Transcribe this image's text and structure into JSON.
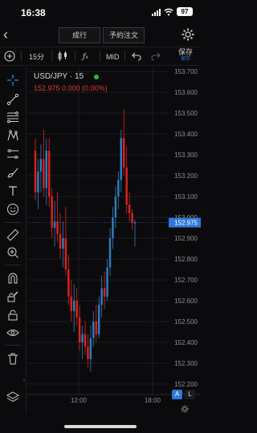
{
  "status": {
    "time": "16:38",
    "battery": "97"
  },
  "topbar": {
    "market_label": "成行",
    "order_label": "予約注文"
  },
  "toolbar": {
    "interval": "15分",
    "price_type": "MID",
    "save_label": "保存",
    "save_sub": "保存"
  },
  "legend": {
    "symbol": "USD/JPY · 15",
    "values": "152.975  0.000 (0.00%)"
  },
  "axis": {
    "price_ticks": [
      "153.700",
      "153.600",
      "153.500",
      "153.400",
      "153.300",
      "153.200",
      "153.100",
      "153.000",
      "152.900",
      "152.800",
      "152.700",
      "152.600",
      "152.500",
      "152.400",
      "152.300",
      "152.200"
    ],
    "current_price": "152.975",
    "time_ticks": [
      "12:00",
      "18:00"
    ]
  },
  "bottom": {
    "auto_label": "A",
    "log_label": "L"
  },
  "colors": {
    "up": "#2f7fc1",
    "down": "#e0211f",
    "accent": "#2f78d9",
    "live_dot": "#2fb54b"
  },
  "icons": [
    "crosshair-icon",
    "trend-line-icon",
    "fib-icon",
    "pattern-icon",
    "projection-icon",
    "brush-icon",
    "text-icon",
    "emoji-icon",
    "ruler-icon",
    "zoom-in-icon",
    "magnet-icon",
    "lock-pencil-icon",
    "lock-icon",
    "eye-icon",
    "trash-icon",
    "layers-icon"
  ],
  "chart_data": {
    "type": "candlestick",
    "symbol": "USD/JPY",
    "interval": "15",
    "x_ticks": [
      "12:00",
      "18:00"
    ],
    "ylim": [
      152.15,
      153.72
    ],
    "candles": [
      {
        "o": 153.32,
        "h": 153.38,
        "l": 153.08,
        "c": 153.12
      },
      {
        "o": 153.12,
        "h": 153.28,
        "l": 153.04,
        "c": 153.22
      },
      {
        "o": 153.22,
        "h": 153.35,
        "l": 153.12,
        "c": 153.28
      },
      {
        "o": 153.28,
        "h": 153.42,
        "l": 153.1,
        "c": 153.14
      },
      {
        "o": 153.14,
        "h": 153.38,
        "l": 153.06,
        "c": 153.32
      },
      {
        "o": 153.32,
        "h": 153.38,
        "l": 153.05,
        "c": 153.1
      },
      {
        "o": 153.1,
        "h": 153.14,
        "l": 152.9,
        "c": 152.95
      },
      {
        "o": 152.95,
        "h": 153.08,
        "l": 152.86,
        "c": 152.98
      },
      {
        "o": 152.98,
        "h": 153.12,
        "l": 152.88,
        "c": 152.92
      },
      {
        "o": 152.92,
        "h": 153.02,
        "l": 152.8,
        "c": 152.85
      },
      {
        "o": 152.85,
        "h": 152.98,
        "l": 152.76,
        "c": 152.9
      },
      {
        "o": 152.9,
        "h": 153.05,
        "l": 152.72,
        "c": 152.75
      },
      {
        "o": 152.75,
        "h": 152.82,
        "l": 152.58,
        "c": 152.62
      },
      {
        "o": 152.62,
        "h": 152.7,
        "l": 152.5,
        "c": 152.55
      },
      {
        "o": 152.55,
        "h": 152.68,
        "l": 152.45,
        "c": 152.6
      },
      {
        "o": 152.6,
        "h": 152.66,
        "l": 152.48,
        "c": 152.52
      },
      {
        "o": 152.52,
        "h": 152.58,
        "l": 152.36,
        "c": 152.4
      },
      {
        "o": 152.4,
        "h": 152.48,
        "l": 152.32,
        "c": 152.44
      },
      {
        "o": 152.44,
        "h": 152.5,
        "l": 152.34,
        "c": 152.38
      },
      {
        "o": 152.38,
        "h": 152.44,
        "l": 152.28,
        "c": 152.32
      },
      {
        "o": 152.32,
        "h": 152.48,
        "l": 152.26,
        "c": 152.42
      },
      {
        "o": 152.42,
        "h": 152.55,
        "l": 152.38,
        "c": 152.5
      },
      {
        "o": 152.5,
        "h": 152.58,
        "l": 152.4,
        "c": 152.44
      },
      {
        "o": 152.44,
        "h": 152.62,
        "l": 152.42,
        "c": 152.58
      },
      {
        "o": 152.58,
        "h": 152.72,
        "l": 152.52,
        "c": 152.66
      },
      {
        "o": 152.66,
        "h": 152.74,
        "l": 152.56,
        "c": 152.62
      },
      {
        "o": 152.62,
        "h": 152.8,
        "l": 152.6,
        "c": 152.76
      },
      {
        "o": 152.76,
        "h": 152.95,
        "l": 152.72,
        "c": 152.9
      },
      {
        "o": 152.9,
        "h": 153.05,
        "l": 152.85,
        "c": 153.0
      },
      {
        "o": 153.0,
        "h": 153.15,
        "l": 152.95,
        "c": 153.1
      },
      {
        "o": 153.1,
        "h": 153.22,
        "l": 153.04,
        "c": 153.18
      },
      {
        "o": 153.18,
        "h": 153.42,
        "l": 153.12,
        "c": 153.38
      },
      {
        "o": 153.38,
        "h": 153.52,
        "l": 153.2,
        "c": 153.24
      },
      {
        "o": 153.24,
        "h": 153.34,
        "l": 153.02,
        "c": 153.06
      },
      {
        "o": 153.06,
        "h": 153.12,
        "l": 152.98,
        "c": 153.02
      },
      {
        "o": 153.02,
        "h": 153.04,
        "l": 152.94,
        "c": 152.975
      },
      {
        "o": 152.975,
        "h": 152.99,
        "l": 152.86,
        "c": 152.975
      }
    ]
  }
}
